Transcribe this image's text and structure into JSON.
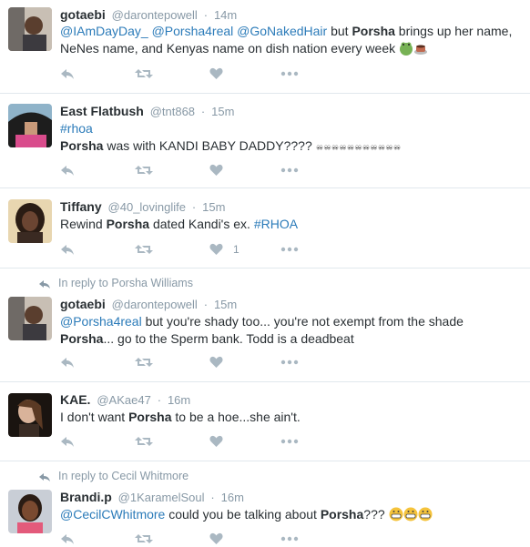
{
  "reply_contexts": [
    {
      "prefix": "In reply to",
      "name": "Porsha Williams"
    },
    {
      "prefix": "In reply to",
      "name": "Cecil Whitmore"
    }
  ],
  "tweets": [
    {
      "name": "gotaebi",
      "handle": "@darontepowell",
      "dot": "·",
      "time": "14m",
      "mentions": [
        "@IAmDayDay_",
        "@Porsha4real",
        "@GoNakedHair"
      ],
      "text_a": " but ",
      "bold": "Porsha",
      "text_b": " brings up her name,",
      "line2": "NeNes name, and Kenyas name on dish nation every week",
      "emoji": [
        "frog-face",
        "coffee"
      ]
    },
    {
      "name": "East Flatbush",
      "handle": "@tnt868",
      "dot": "·",
      "time": "15m",
      "hashtag": "#rhoa",
      "bold": "Porsha",
      "text": " was with KANDI BABY DADDY????",
      "emoji": [
        "eyes-row"
      ]
    },
    {
      "name": "Tiffany",
      "handle": "@40_lovinglife",
      "dot": "·",
      "time": "15m",
      "text_a": "Rewind ",
      "bold": "Porsha",
      "text_b": " dated Kandi's ex. ",
      "hashtag": "#RHOA",
      "fav_count": "1"
    },
    {
      "name": "gotaebi",
      "handle": "@darontepowell",
      "dot": "·",
      "time": "15m",
      "mention": "@Porsha4real",
      "text_a": " but you're shady too... you're not exempt from the shade",
      "bold": "Porsha",
      "text_b": "... go to the Sperm bank. Todd is a deadbeat"
    },
    {
      "name": "KAE.",
      "handle": "@AKae47",
      "dot": "·",
      "time": "16m",
      "text_a": "I don't want ",
      "bold": "Porsha",
      "text_b": " to be a hoe...she ain't."
    },
    {
      "name": "Brandi.p",
      "handle": "@1KaramelSoul",
      "dot": "·",
      "time": "16m",
      "mention": "@CecilCWhitmore",
      "text_a": " could you be talking about ",
      "bold": "Porsha",
      "text_b": "???",
      "emoji": [
        "grimace",
        "grimace",
        "grimace"
      ]
    }
  ],
  "colors": {
    "link": "#2b7bb9",
    "muted": "#8899a6",
    "text": "#292f33",
    "divider": "#e1e8ed",
    "emoji": "#f5c33b"
  }
}
